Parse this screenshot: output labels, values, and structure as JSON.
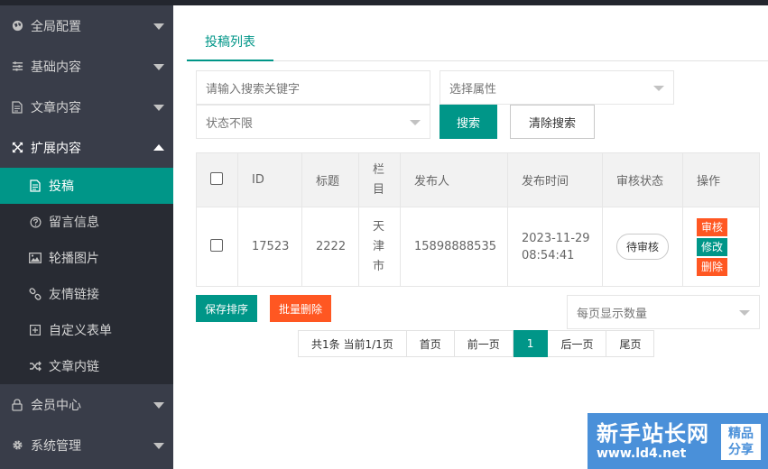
{
  "sidebar": {
    "menu": [
      {
        "label": "全局配置",
        "icon": "globe-icon"
      },
      {
        "label": "基础内容",
        "icon": "sliders-icon"
      },
      {
        "label": "文章内容",
        "icon": "document-icon"
      },
      {
        "label": "扩展内容",
        "icon": "expand-icon"
      }
    ],
    "sub_items": [
      {
        "label": "投稿",
        "icon": "document-icon"
      },
      {
        "label": "留言信息",
        "icon": "question-icon"
      },
      {
        "label": "轮播图片",
        "icon": "image-icon"
      },
      {
        "label": "友情链接",
        "icon": "link-icon"
      },
      {
        "label": "自定义表单",
        "icon": "plus-square-icon"
      },
      {
        "label": "文章内链",
        "icon": "shuffle-icon"
      }
    ],
    "bottom": [
      {
        "label": "会员中心",
        "icon": "lock-icon"
      },
      {
        "label": "系统管理",
        "icon": "gear-icon"
      }
    ]
  },
  "tabs": {
    "active": "投稿列表"
  },
  "filters": {
    "search_placeholder": "请输入搜索关键字",
    "attribute_select": "选择属性",
    "status_select": "状态不限",
    "search_button": "搜索",
    "clear_button": "清除搜索"
  },
  "table": {
    "headers": {
      "id": "ID",
      "title": "标题",
      "category": "栏目",
      "publisher": "发布人",
      "time": "发布时间",
      "status": "审核状态",
      "actions": "操作"
    },
    "row": {
      "id": "17523",
      "title": "2222",
      "category": "天津市",
      "publisher": "15898888535",
      "date": "2023-11-29",
      "time": "08:54:41",
      "status": "待审核",
      "op_review": "审核",
      "op_edit": "修改",
      "op_delete": "删除"
    }
  },
  "actions": {
    "save_order": "保存排序",
    "batch_delete": "批量删除",
    "per_page_placeholder": "每页显示数量"
  },
  "pager": {
    "summary": "共1条 当前1/1页",
    "first": "首页",
    "prev": "前一页",
    "current": "1",
    "next": "后一页",
    "last": "尾页"
  },
  "watermark": {
    "title": "新手站长网",
    "url": "www.ld4.net",
    "badge_line1": "精品",
    "badge_line2": "分享"
  },
  "colors": {
    "primary": "#009688",
    "orange": "#ff5722",
    "sidebar": "#393d49",
    "subnav": "#282b33"
  }
}
